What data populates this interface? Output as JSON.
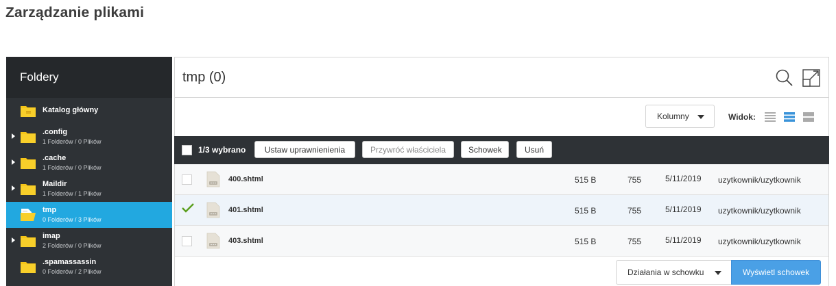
{
  "page": {
    "title": "Zarządzanie plikami"
  },
  "sidebar": {
    "header": "Foldery",
    "items": [
      {
        "name": "Katalog główny",
        "meta": "",
        "expandable": false,
        "selected": false,
        "icon": "root-folder-icon"
      },
      {
        "name": ".config",
        "meta": "1 Folderów / 0 Plików",
        "expandable": true,
        "selected": false,
        "icon": "folder-icon"
      },
      {
        "name": ".cache",
        "meta": "1 Folderów / 0 Plików",
        "expandable": true,
        "selected": false,
        "icon": "folder-icon"
      },
      {
        "name": "Maildir",
        "meta": "1 Folderów / 1 Plików",
        "expandable": true,
        "selected": false,
        "icon": "folder-icon"
      },
      {
        "name": "tmp",
        "meta": "0 Folderów / 3 Plików",
        "expandable": false,
        "selected": true,
        "icon": "open-folder-icon"
      },
      {
        "name": "imap",
        "meta": "2 Folderów / 0 Plików",
        "expandable": true,
        "selected": false,
        "icon": "folder-icon"
      },
      {
        "name": ".spamassassin",
        "meta": "0 Folderów / 2 Plików",
        "expandable": false,
        "selected": false,
        "icon": "folder-icon"
      }
    ]
  },
  "main": {
    "title": "tmp  (0)",
    "toolbar": {
      "columns_label": "Kolumny",
      "view_label": "Widok:",
      "active_view": "compact"
    },
    "selection_bar": {
      "count_label": "1/3 wybrano",
      "perms_label": "Ustaw uprawnienienia",
      "owner_label": "Przywróć właściciela",
      "clipboard_label": "Schowek",
      "delete_label": "Usuń"
    },
    "files": [
      {
        "name": "400.shtml",
        "size": "515 B",
        "perm": "755",
        "date": "5/11/2019",
        "owner": "uzytkownik/uzytkownik",
        "checked": false
      },
      {
        "name": "401.shtml",
        "size": "515 B",
        "perm": "755",
        "date": "5/11/2019",
        "owner": "uzytkownik/uzytkownik",
        "checked": true
      },
      {
        "name": "403.shtml",
        "size": "515 B",
        "perm": "755",
        "date": "5/11/2019",
        "owner": "uzytkownik/uzytkownik",
        "checked": false
      }
    ],
    "footer": {
      "clipboard_actions_label": "Działania w schowku",
      "show_clipboard_label": "Wyświetl schowek"
    }
  },
  "colors": {
    "accent": "#22a8e0",
    "sidebar_bg": "#2e3236",
    "folder_yellow": "#f5c518",
    "primary_button": "#4aa0e6",
    "check_green": "#5a9e1c"
  }
}
